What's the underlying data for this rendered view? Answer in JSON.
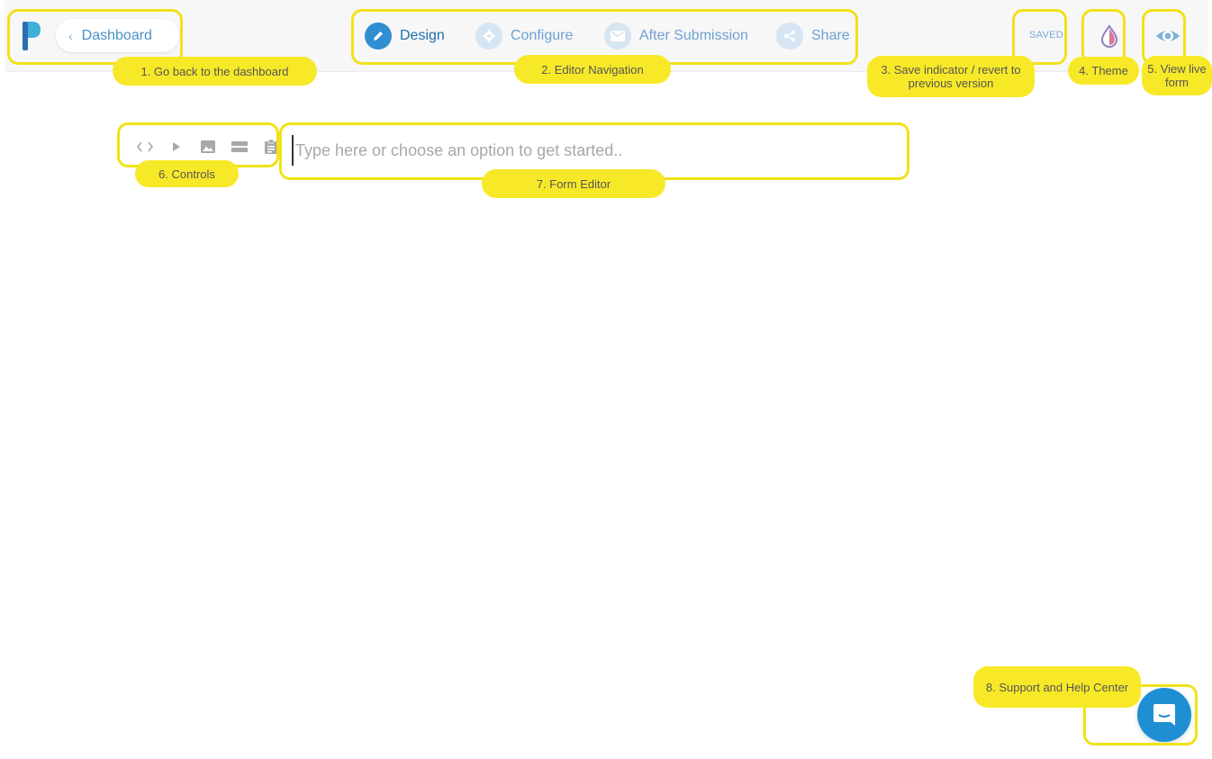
{
  "header": {
    "back_label": "Dashboard",
    "nav": [
      {
        "label": "Design",
        "icon": "pencil-icon",
        "active": true
      },
      {
        "label": "Configure",
        "icon": "gear-icon",
        "active": false
      },
      {
        "label": "After Submission",
        "icon": "mail-icon",
        "active": false
      },
      {
        "label": "Share",
        "icon": "share-icon",
        "active": false
      }
    ],
    "status": "SAVED",
    "theme_icon": "droplet-icon",
    "preview_icon": "eye-icon"
  },
  "editor": {
    "controls": [
      "code-icon",
      "play-icon",
      "image-icon",
      "divider-icon",
      "clipboard-icon"
    ],
    "placeholder": "Type here or choose an option to get started.."
  },
  "support": {
    "icon": "chat-icon"
  },
  "annotations": [
    "1. Go back to the dashboard",
    "2. Editor Navigation",
    "3. Save indicator / revert to previous version",
    "4. Theme",
    "5. View live form",
    "6. Controls",
    "7. Form Editor",
    "8. Support and Help Center"
  ],
  "colors": {
    "accent": "#2f8fd0",
    "link": "#4a90c8",
    "highlight": "#f1e219",
    "tag_bg": "#f7e928"
  }
}
